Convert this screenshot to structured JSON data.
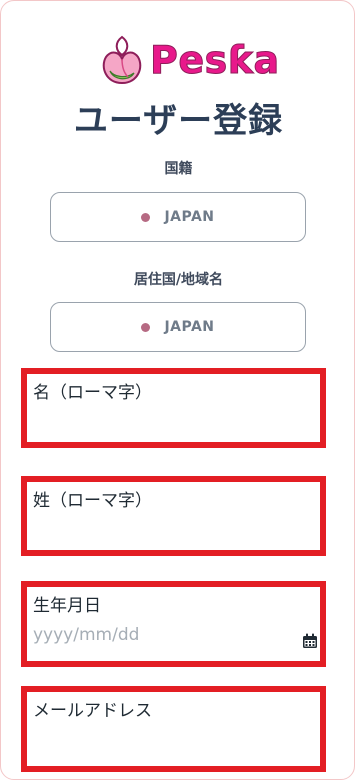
{
  "brand": {
    "logo_text": "Pesƙa"
  },
  "page": {
    "title": "ユーザー登録"
  },
  "nationality": {
    "label": "国籍",
    "value": "JAPAN"
  },
  "residence": {
    "label": "居住国/地域名",
    "value": "JAPAN"
  },
  "form": {
    "first_name_label": "名（ローマ字）",
    "last_name_label": "姓（ローマ字）",
    "birthdate_label": "生年月日",
    "birthdate_placeholder": "yyyy/mm/dd",
    "email_label": "メールアドレス"
  },
  "colors": {
    "highlight_border": "#e31e24",
    "title": "#2c3e57",
    "brand_pink": "#e8198b"
  },
  "icons": {
    "logo": "peach-logo-icon",
    "calendar": "calendar-icon"
  }
}
